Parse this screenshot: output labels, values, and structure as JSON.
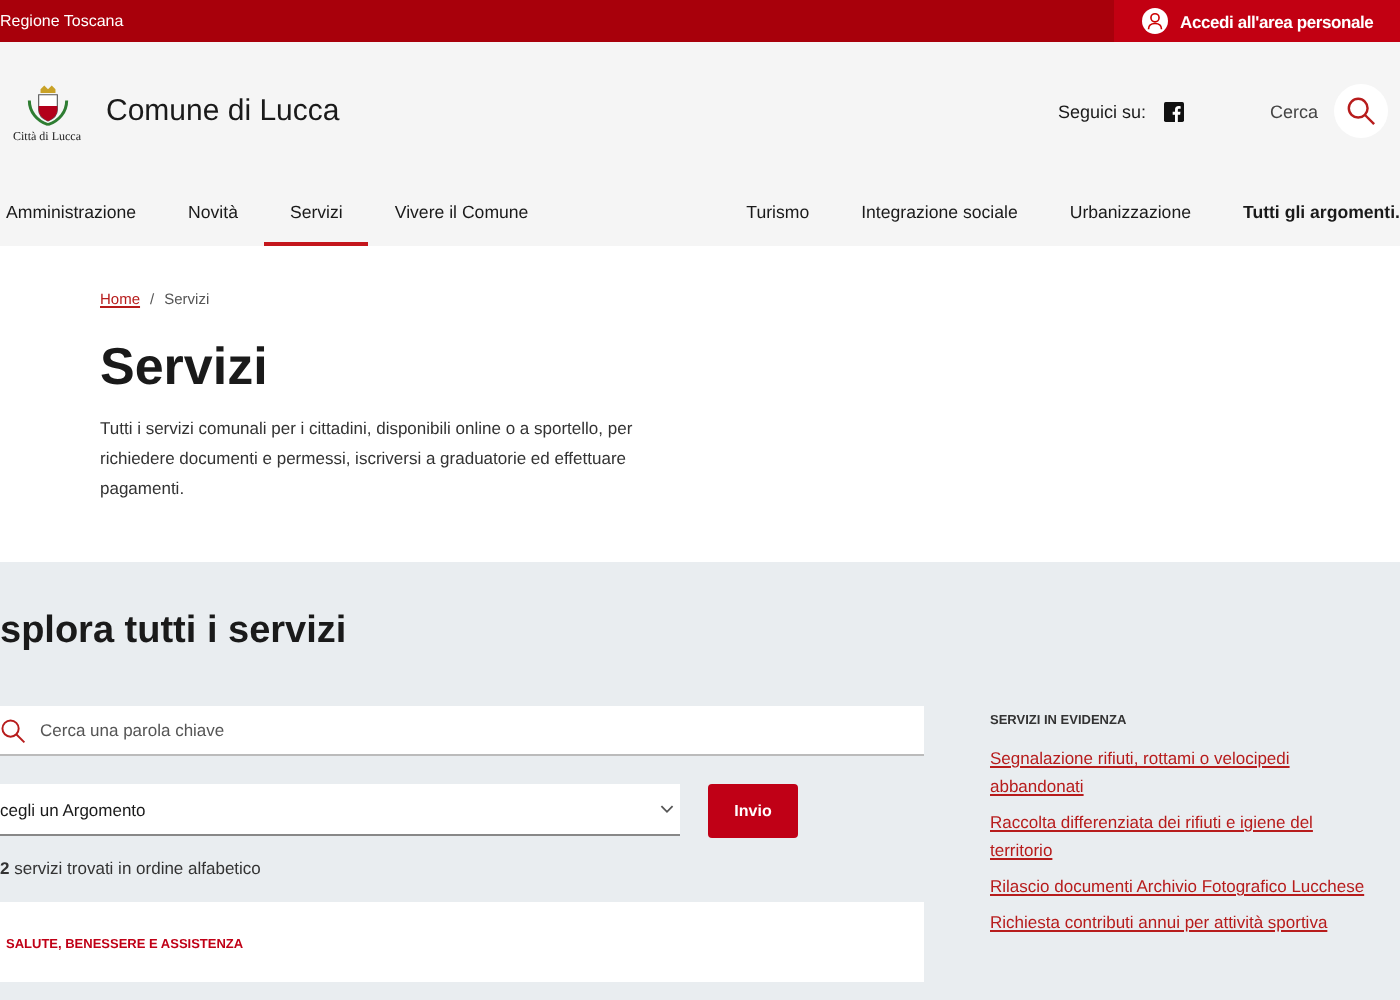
{
  "top_bar": {
    "region": "Regione Toscana",
    "login": "Accedi all'area personale"
  },
  "header": {
    "logo_caption": "Città di Lucca",
    "site_name": "Comune di Lucca",
    "social_label": "Seguici su:",
    "search_label": "Cerca"
  },
  "nav": {
    "left": [
      {
        "label": "Amministrazione",
        "selected": false
      },
      {
        "label": "Novità",
        "selected": false
      },
      {
        "label": "Servizi",
        "selected": true
      },
      {
        "label": "Vivere il Comune",
        "selected": false
      }
    ],
    "right": [
      {
        "label": "Turismo",
        "bold": false
      },
      {
        "label": "Integrazione sociale",
        "bold": false
      },
      {
        "label": "Urbanizzazione",
        "bold": false
      },
      {
        "label": "Tutti gli argomenti.",
        "bold": true
      }
    ]
  },
  "breadcrumb_separator": "/",
  "breadcrumb": [
    {
      "label": "Home",
      "link": true
    },
    {
      "label": "Servizi",
      "link": false
    }
  ],
  "title": "Servizi",
  "intro": "Tutti i servizi comunali per i cittadini, disponibili online o a sportello, per richiedere documenti e permessi, iscriversi a graduatorie ed effettuare pagamenti.",
  "explore": {
    "title": "splora tutti i servizi",
    "search": {
      "placeholder": "Cerca una parola chiave"
    },
    "topic_select": {
      "value": "cegli un Argomento"
    },
    "submit": "Invio",
    "count": "2",
    "count_text": "servizi trovati in ordine alfabetico",
    "first_category": "SALUTE, BENESSERE E ASSISTENZA"
  },
  "featured": {
    "heading": "SERVIZI IN EVIDENZA",
    "links": [
      "Segnalazione rifiuti, rottami o velocipedi abbandonati",
      "Raccolta differenziata dei rifiuti e igiene del territorio",
      "Rilascio documenti Archivio Fotografico Lucchese",
      "Richiesta contributi annui per attività sportiva"
    ]
  }
}
